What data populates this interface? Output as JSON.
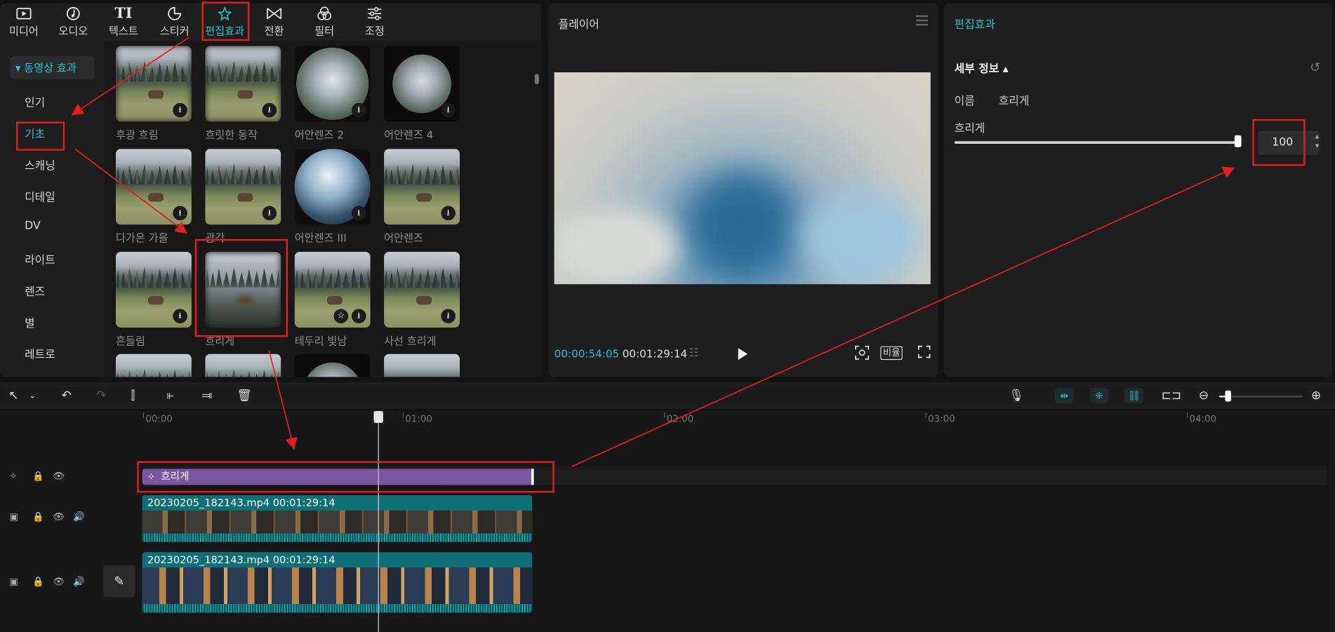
{
  "top_tabs": [
    {
      "label": "미디어",
      "icon": "media-icon"
    },
    {
      "label": "오디오",
      "icon": "audio-icon"
    },
    {
      "label": "텍스트",
      "icon": "text-icon"
    },
    {
      "label": "스티커",
      "icon": "sticker-icon"
    },
    {
      "label": "편집효과",
      "icon": "effects-icon",
      "active": true
    },
    {
      "label": "전환",
      "icon": "transition-icon"
    },
    {
      "label": "필터",
      "icon": "filter-icon"
    },
    {
      "label": "조정",
      "icon": "adjust-icon"
    }
  ],
  "sidebar": {
    "header": "▾ 동영상 효과",
    "items": [
      "인기",
      "기초",
      "스캐닝",
      "디테일",
      "DV",
      "라이트",
      "렌즈",
      "별",
      "레트로"
    ],
    "active": "기초"
  },
  "effects": [
    {
      "label": "후광 흐림"
    },
    {
      "label": "흐릿한 동작"
    },
    {
      "label": "어안렌즈 2"
    },
    {
      "label": "어안렌즈 4"
    },
    {
      "label": "다가온 가을"
    },
    {
      "label": "광각"
    },
    {
      "label": "어안렌즈 III"
    },
    {
      "label": "어안렌즈"
    },
    {
      "label": "흔들림"
    },
    {
      "label": "흐리게"
    },
    {
      "label": "테두리 빛남"
    },
    {
      "label": "사선 흐리게"
    }
  ],
  "player": {
    "title": "플레이어",
    "current_time": "00:00:54:05",
    "total_time": "00:01:29:14",
    "ratio_label": "비율"
  },
  "props": {
    "title": "편집효과",
    "section": "세부 정보 ▴",
    "name_label": "이름",
    "name_value": "흐리게",
    "blur_label": "흐리게",
    "blur_value": "100",
    "blur_level": 1.0
  },
  "timeline": {
    "ruler": [
      "00:00",
      "01:00",
      "02:00",
      "03:00",
      "04:00"
    ],
    "effect_clip": "흐리게",
    "video_clips": [
      {
        "caption": "20230205_182143.mp4   00:01:29:14"
      },
      {
        "caption": "20230205_182143.mp4   00:01:29:14"
      }
    ],
    "zoom_level": 0.1
  },
  "colors": {
    "accent": "#21c3cf",
    "annotation": "#e41e1e",
    "effect_clip": "#7a55a0",
    "video_clip": "#0f6f76"
  }
}
